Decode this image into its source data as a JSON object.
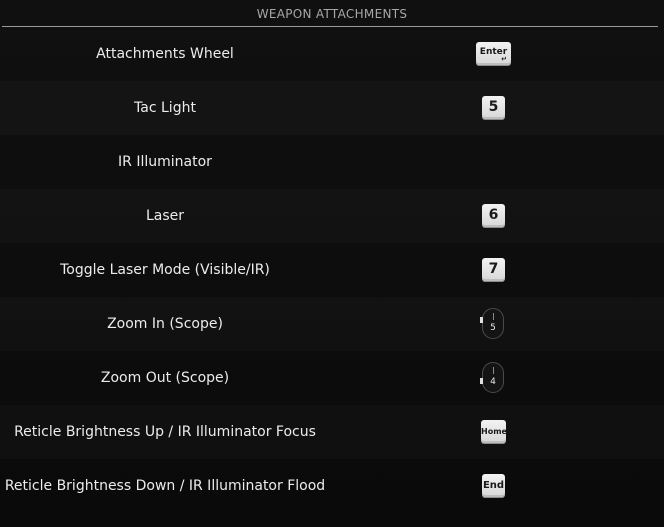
{
  "header": {
    "title": "WEAPON ATTACHMENTS"
  },
  "rows": [
    {
      "label": "Attachments Wheel",
      "key": "Enter",
      "key_type": "enter"
    },
    {
      "label": "Tac Light",
      "key": "5",
      "key_type": "key"
    },
    {
      "label": "IR Illuminator",
      "key": "",
      "key_type": "none"
    },
    {
      "label": "Laser",
      "key": "6",
      "key_type": "key"
    },
    {
      "label": "Toggle Laser Mode (Visible/IR)",
      "key": "7",
      "key_type": "key"
    },
    {
      "label": "Zoom In (Scope)",
      "key": "5",
      "key_type": "mouse-wheel-up"
    },
    {
      "label": "Zoom Out (Scope)",
      "key": "4",
      "key_type": "mouse-wheel-down"
    },
    {
      "label": "Reticle Brightness Up / IR Illuminator Focus",
      "key": "Home",
      "key_type": "key"
    },
    {
      "label": "Reticle Brightness Down / IR Illuminator Flood",
      "key": "End",
      "key_type": "key"
    }
  ]
}
